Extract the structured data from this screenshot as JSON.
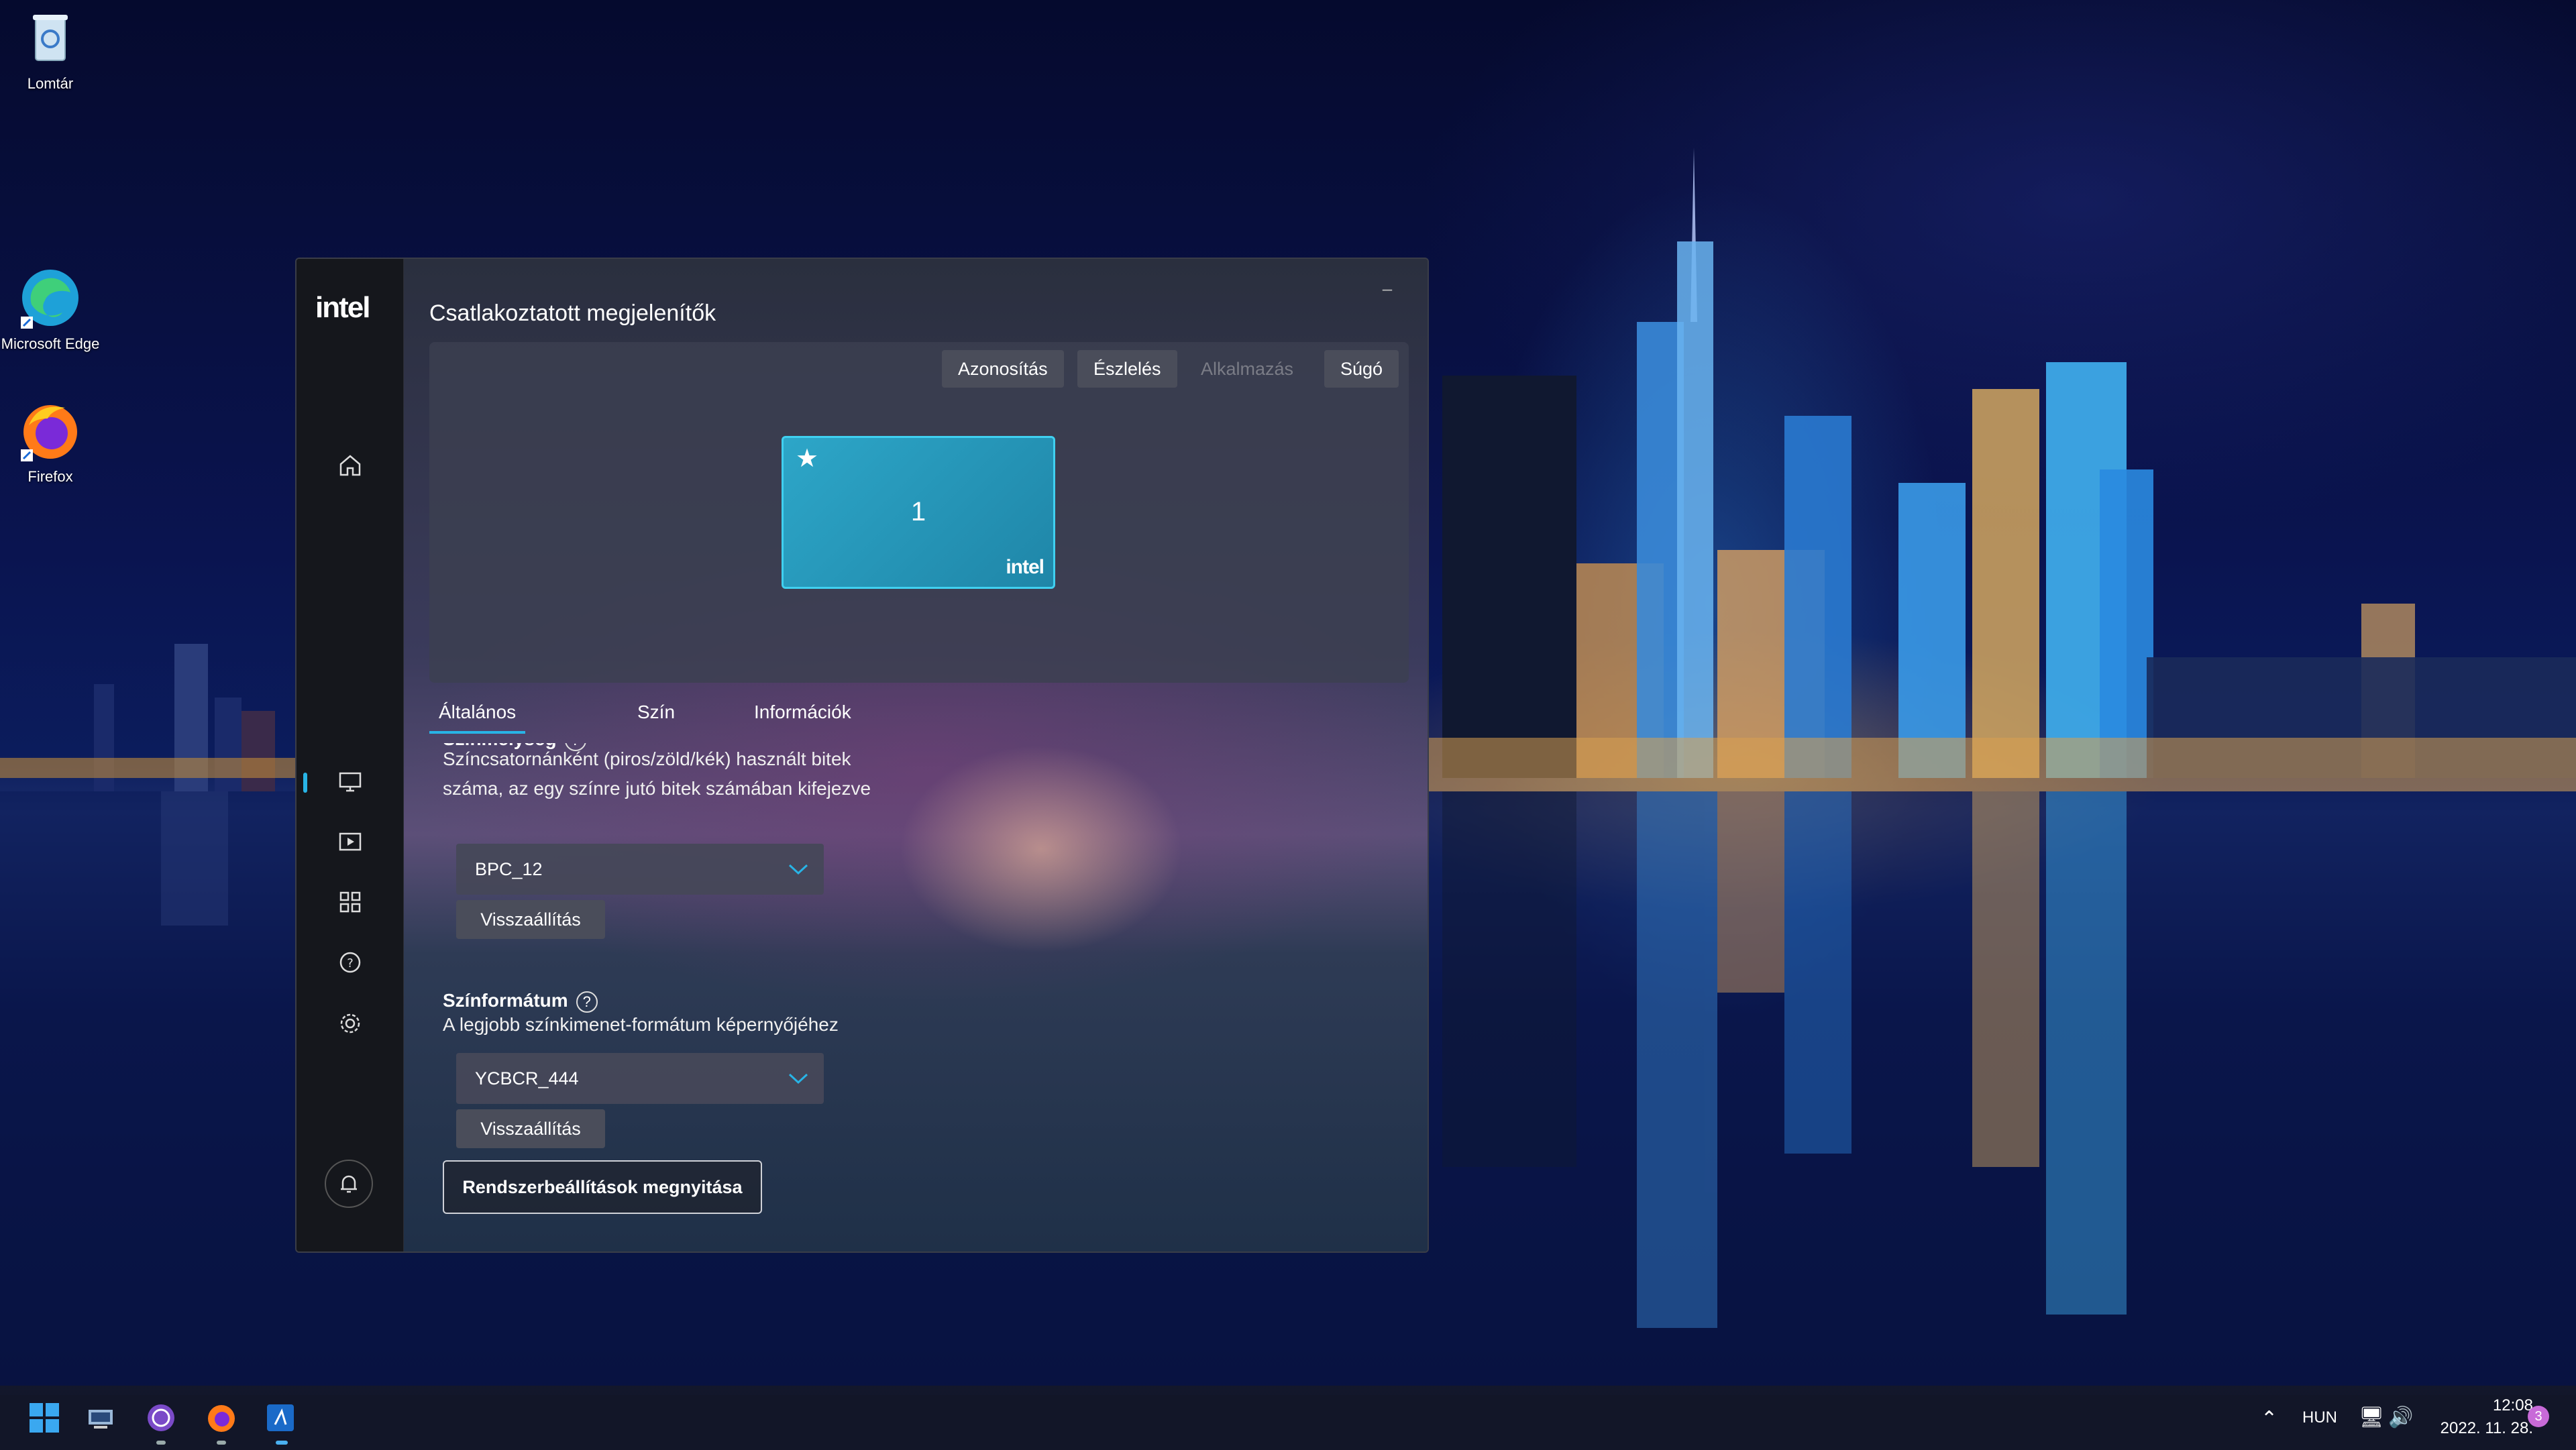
{
  "desktop": {
    "icons": [
      {
        "label": "Lomtár"
      },
      {
        "label": "Microsoft Edge"
      },
      {
        "label": "Firefox"
      }
    ]
  },
  "window": {
    "title": "Csatlakoztatott megjelenítők",
    "logo": "intel",
    "controls": {
      "minimize": "–",
      "maximize": "☐",
      "close": "✕"
    },
    "toolbar": {
      "identify": "Azonosítás",
      "detect": "Észlelés",
      "apply": "Alkalmazás",
      "help": "Súgó"
    },
    "monitor": {
      "number": "1",
      "star": "★",
      "logo": "intel",
      "accent": "#2da6c8"
    },
    "tabs": [
      {
        "label": "Általános",
        "active": true
      },
      {
        "label": "Szín",
        "active": false
      },
      {
        "label": "Információk",
        "active": false
      }
    ],
    "bit_depth": {
      "title": "Színmélység",
      "description_line1": "Színcsatornánként (piros/zöld/kék) használt bitek",
      "description_line2": "száma, az egy színre jutó bitek számában kifejezve",
      "value": "BPC_12",
      "reset": "Visszaállítás"
    },
    "color_format": {
      "title": "Színformátum",
      "help": "?",
      "description": "A legjobb színkimenet-formátum képernyőjéhez",
      "value": "YCBCR_444",
      "reset": "Visszaállítás"
    },
    "system_settings_button": "Rendszerbeállítások megnyitása"
  },
  "taskbar": {
    "tray": {
      "language": "HUN",
      "time": "12:08",
      "date": "2022. 11. 28.",
      "notification_count": "3"
    }
  }
}
